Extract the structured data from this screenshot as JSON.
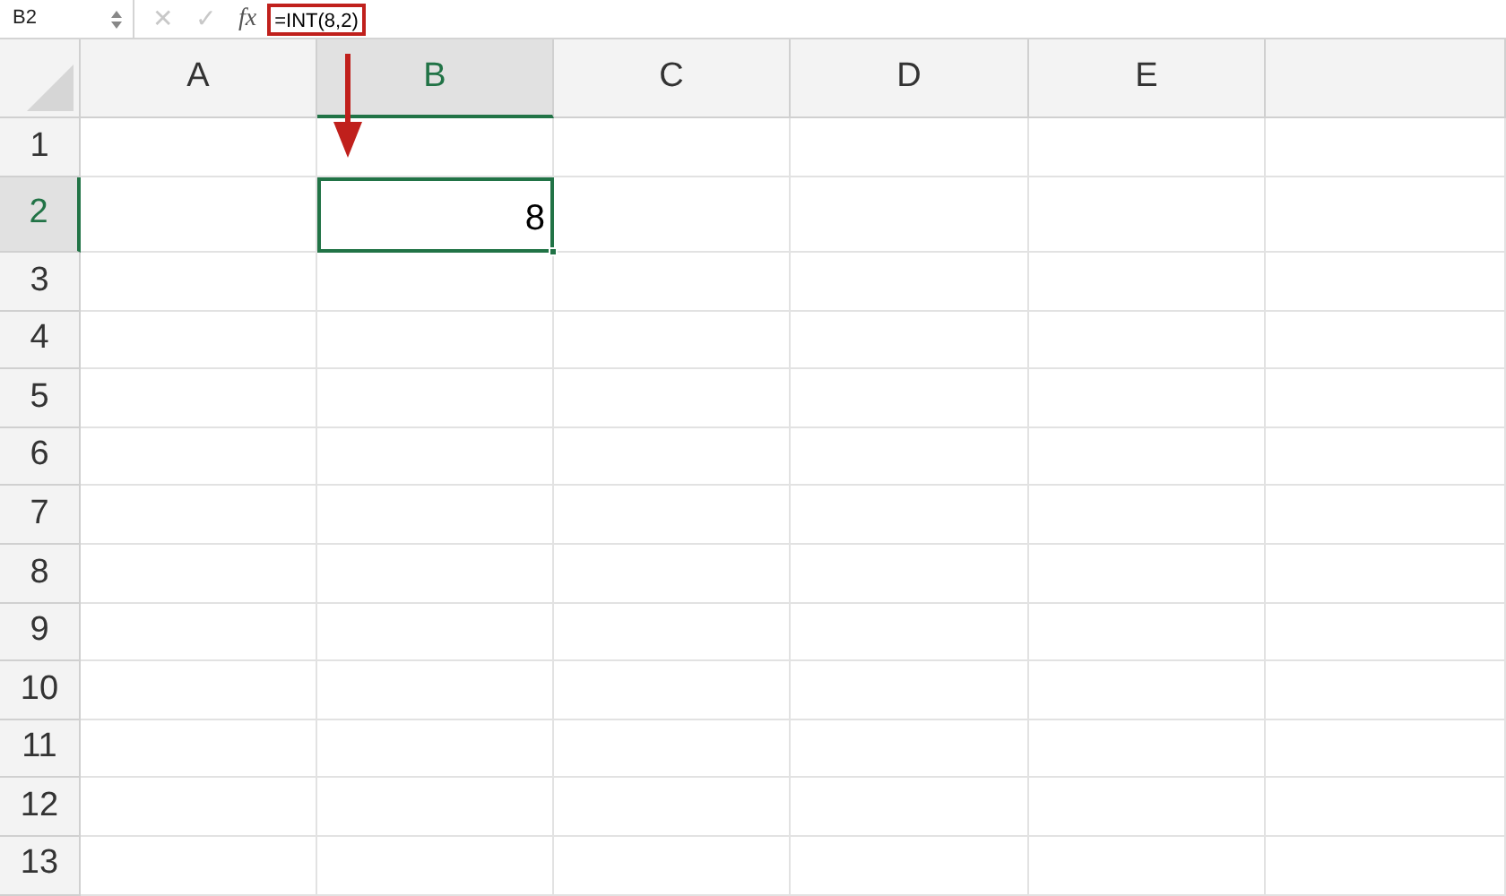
{
  "formula_bar": {
    "name_box": "B2",
    "cancel": "✕",
    "enter": "✓",
    "fx": "fx",
    "formula": "=INT(8,2)",
    "formula_highlighted": true
  },
  "columns": [
    {
      "label": "A",
      "selected": false
    },
    {
      "label": "B",
      "selected": true
    },
    {
      "label": "C",
      "selected": false
    },
    {
      "label": "D",
      "selected": false
    },
    {
      "label": "E",
      "selected": false
    },
    {
      "selected": false
    }
  ],
  "rows": [
    {
      "label": "1",
      "selected": false
    },
    {
      "label": "2",
      "selected": true,
      "cells": [
        null,
        "8"
      ]
    },
    {
      "label": "3",
      "selected": false
    },
    {
      "label": "4",
      "selected": false
    },
    {
      "label": "5",
      "selected": false
    },
    {
      "label": "6",
      "selected": false
    },
    {
      "label": "7",
      "selected": false
    },
    {
      "label": "8",
      "selected": false
    },
    {
      "label": "9",
      "selected": false
    },
    {
      "label": "10",
      "selected": false
    },
    {
      "label": "11",
      "selected": false
    },
    {
      "label": "12",
      "selected": false
    },
    {
      "label": "13",
      "selected": false
    }
  ],
  "annotation": {
    "kind": "arrow"
  }
}
